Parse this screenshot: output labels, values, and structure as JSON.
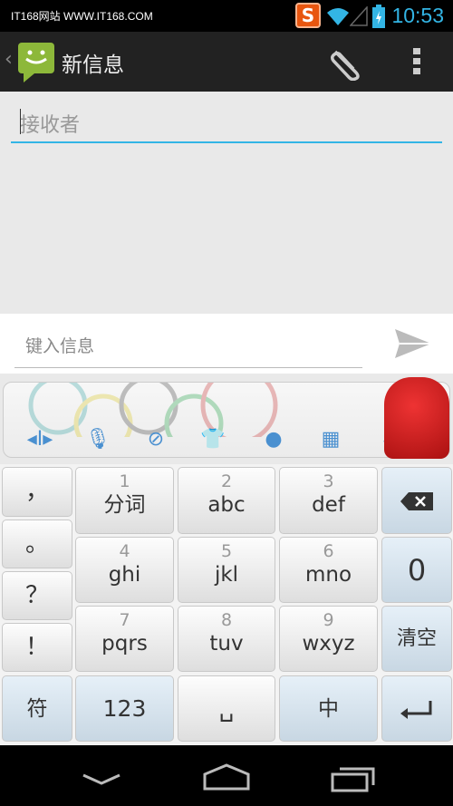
{
  "status_bar": {
    "notification_text": "IT168网站 WWW.IT168.COM",
    "time": "10:53",
    "icons": [
      "sogou-ime-icon",
      "wifi-icon",
      "signal-icon",
      "battery-charging-icon"
    ]
  },
  "action_bar": {
    "title": "新信息",
    "icons": [
      "back-icon",
      "messaging-app-icon",
      "attach-icon",
      "overflow-menu-icon"
    ]
  },
  "recipients": {
    "placeholder": "接收者"
  },
  "compose": {
    "placeholder": "键入信息",
    "send_icon": "send-icon"
  },
  "ime_toolbar": {
    "icons": [
      "cursor-move-icon",
      "microphone-icon",
      "clipboard-play-icon",
      "skin-shirt-icon",
      "hot-words-icon",
      "qr-code-icon",
      "collapse-chevron-icon"
    ]
  },
  "keyboard": {
    "punctuation": [
      "，",
      "。",
      "？",
      "！"
    ],
    "keys": [
      {
        "num": "1",
        "label": "分词"
      },
      {
        "num": "2",
        "label": "abc"
      },
      {
        "num": "3",
        "label": "def"
      },
      {
        "num": "4",
        "label": "ghi"
      },
      {
        "num": "5",
        "label": "jkl"
      },
      {
        "num": "6",
        "label": "mno"
      },
      {
        "num": "7",
        "label": "pqrs"
      },
      {
        "num": "8",
        "label": "tuv"
      },
      {
        "num": "9",
        "label": "wxyz"
      }
    ],
    "zero": "0",
    "clear": "清空",
    "symbols": "符",
    "numbers": "123",
    "space": "␣",
    "lang": "中",
    "backspace_icon": "backspace-icon",
    "enter_icon": "enter-icon"
  },
  "nav_bar": {
    "icons": [
      "back-icon",
      "home-icon",
      "recent-apps-icon"
    ]
  }
}
